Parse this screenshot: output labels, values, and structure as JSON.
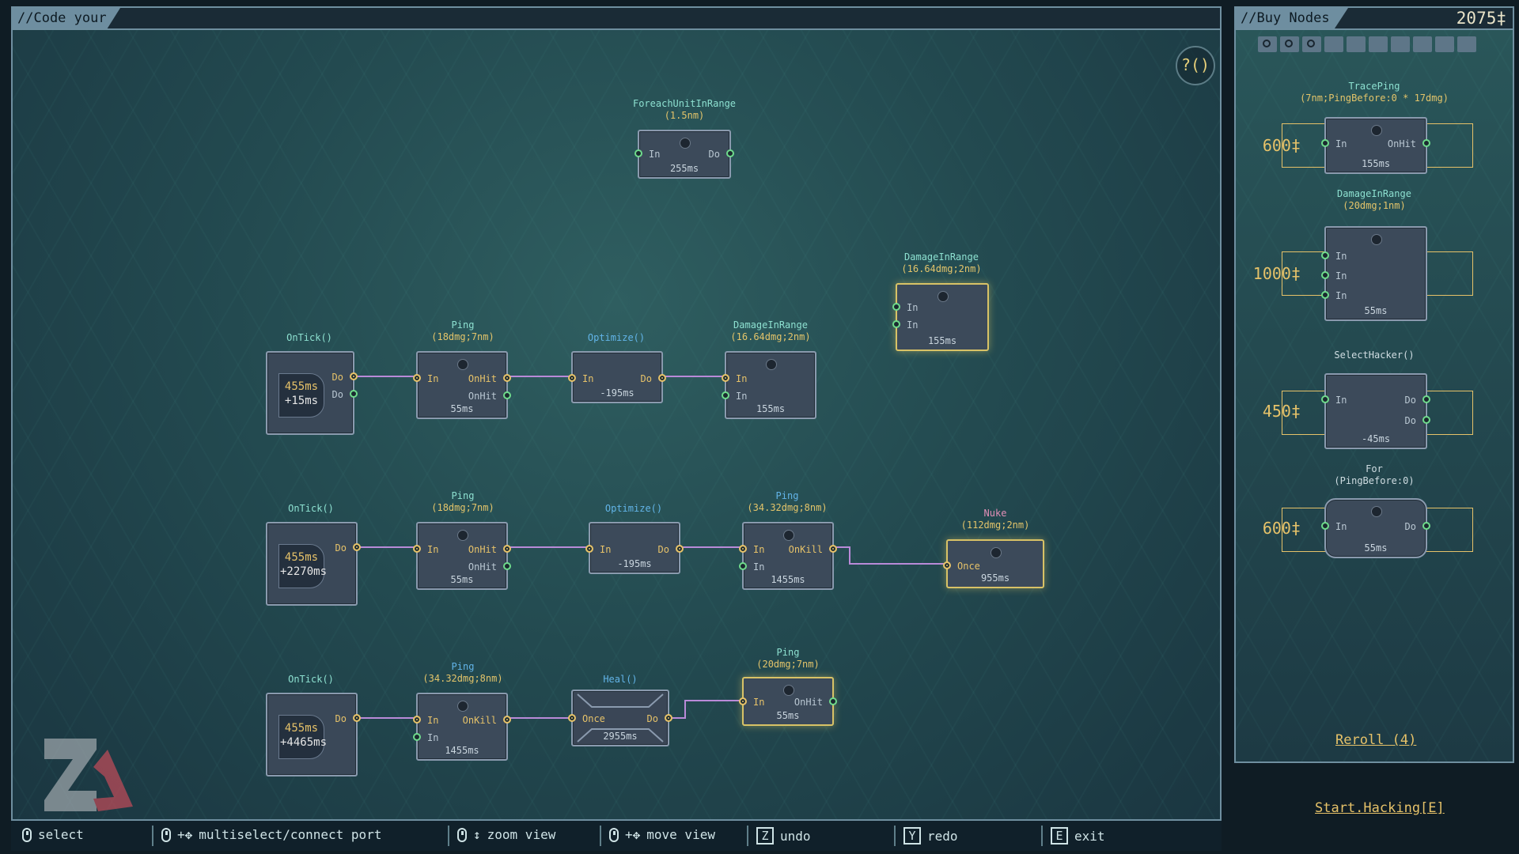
{
  "editor": {
    "title": "//Code your Virus",
    "help_label": "?()"
  },
  "nodes": {
    "foreach": {
      "name": "ForeachUnitInRange",
      "sub": "(1.5nm)",
      "in": "In",
      "out": "Do",
      "time": "255ms"
    },
    "dmg_float": {
      "name": "DamageInRange",
      "sub": "(16.64dmg;2nm)",
      "in1": "In",
      "in2": "In",
      "time": "155ms"
    },
    "r1_tick": {
      "name": "OnTick()",
      "time": "455ms",
      "add": "+15ms",
      "out1": "Do",
      "out2": "Do"
    },
    "r1_ping": {
      "name": "Ping",
      "sub": "(18dmg;7nm)",
      "in": "In",
      "out1": "OnHit",
      "out2": "OnHit",
      "time": "55ms"
    },
    "r1_opt": {
      "name": "Optimize()",
      "in": "In",
      "out": "Do",
      "time": "-195ms"
    },
    "r1_dmg": {
      "name": "DamageInRange",
      "sub": "(16.64dmg;2nm)",
      "in1": "In",
      "in2": "In",
      "time": "155ms"
    },
    "r2_tick": {
      "name": "OnTick()",
      "time": "455ms",
      "add": "+2270ms",
      "out": "Do"
    },
    "r2_ping": {
      "name": "Ping",
      "sub": "(18dmg;7nm)",
      "in": "In",
      "out1": "OnHit",
      "out2": "OnHit",
      "time": "55ms"
    },
    "r2_opt": {
      "name": "Optimize()",
      "in": "In",
      "out": "Do",
      "time": "-195ms"
    },
    "r2_ping2": {
      "name": "Ping",
      "sub": "(34.32dmg;8nm)",
      "in1": "In",
      "in2": "In",
      "out": "OnKill",
      "time": "1455ms"
    },
    "r2_nuke": {
      "name": "Nuke",
      "sub": "(112dmg;2nm)",
      "in": "Once",
      "time": "955ms"
    },
    "r3_tick": {
      "name": "OnTick()",
      "time": "455ms",
      "add": "+4465ms",
      "out": "Do"
    },
    "r3_ping": {
      "name": "Ping",
      "sub": "(34.32dmg;8nm)",
      "in1": "In",
      "in2": "In",
      "out": "OnKill",
      "time": "1455ms"
    },
    "r3_heal": {
      "name": "Heal()",
      "in": "Once",
      "out": "Do",
      "time": "2955ms"
    },
    "r3_ping2": {
      "name": "Ping",
      "sub": "(20dmg;7nm)",
      "in": "In",
      "out": "OnHit",
      "time": "55ms"
    }
  },
  "shop": {
    "title": "//Buy Nodes",
    "money": "2075‡",
    "icons": [
      "refresh-icon",
      "refresh-icon",
      "refresh-icon",
      "slot-icon",
      "slot-icon",
      "slot-icon",
      "slot-icon",
      "slot-icon",
      "slot-icon",
      "slot-icon"
    ],
    "items": [
      {
        "name": "TracePing",
        "sub": "(7nm;PingBefore:0 * 17dmg)",
        "price": "600‡",
        "in": "In",
        "out": "OnHit",
        "time": "155ms"
      },
      {
        "name": "DamageInRange",
        "sub": "(20dmg;1nm)",
        "price": "1000‡",
        "in1": "In",
        "in2": "In",
        "in3": "In",
        "time": "55ms"
      },
      {
        "name": "SelectHacker()",
        "price": "450‡",
        "in": "In",
        "out1": "Do",
        "out2": "Do",
        "time": "-45ms"
      },
      {
        "name": "For",
        "sub": "(PingBefore:0)",
        "price": "600‡",
        "in": "In",
        "out": "Do",
        "time": "55ms"
      }
    ],
    "reroll": "Reroll (4)",
    "start": "Start.Hacking[E]"
  },
  "footer": {
    "select": "select",
    "multiselect": "multiselect/connect port",
    "zoom": "zoom view",
    "move": "move view",
    "undo_key": "Z",
    "undo": "undo",
    "redo_key": "Y",
    "redo": "redo",
    "exit_key": "E",
    "exit": "exit"
  },
  "colors": {
    "accent_gold": "#e6c269",
    "port_green": "#6fdc8c",
    "wire_purple": "#b98ad8"
  }
}
